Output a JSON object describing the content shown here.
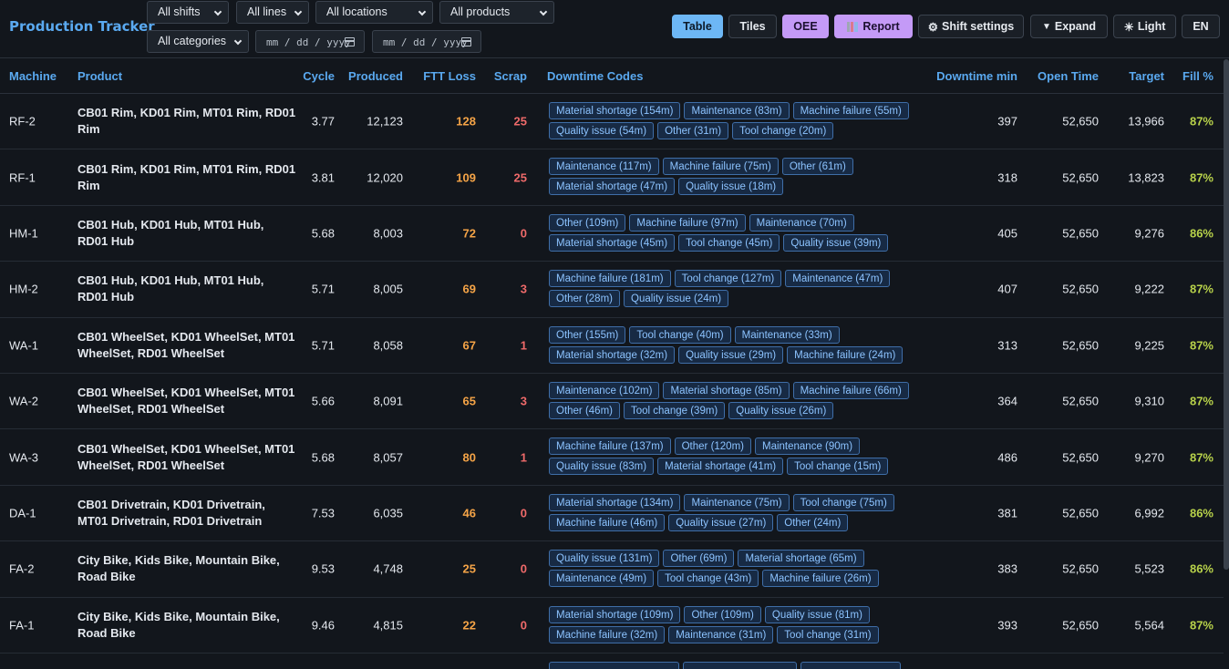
{
  "app": {
    "title": "Production Tracker"
  },
  "filters": {
    "shifts": "All shifts",
    "lines": "All lines",
    "locations": "All locations",
    "products": "All products",
    "categories": "All categories",
    "date_from_placeholder": "mm / dd / yyyy",
    "date_to_placeholder": "mm / dd / yyyy"
  },
  "toolbar": {
    "table": "Table",
    "tiles": "Tiles",
    "oee": "OEE",
    "report": "Report",
    "shift_settings": "Shift settings",
    "expand": "Expand",
    "light": "Light",
    "lang": "EN"
  },
  "colors": {
    "accent": "#5aa9f0",
    "ftt": "#f5a447",
    "scrap": "#ef6a6a",
    "fill": "#b8d24a",
    "active_view": "#6db7f5",
    "purple": "#c49af7"
  },
  "table": {
    "headers": {
      "machine": "Machine",
      "product": "Product",
      "cycle": "Cycle",
      "produced": "Produced",
      "ftt_loss": "FTT Loss",
      "scrap": "Scrap",
      "downtime_codes": "Downtime Codes",
      "downtime_min": "Downtime min",
      "open_time": "Open Time",
      "target": "Target",
      "fill": "Fill %"
    },
    "rows": [
      {
        "machine": "RF-2",
        "product": "CB01 Rim, KD01 Rim, MT01 Rim, RD01 Rim",
        "cycle": "3.77",
        "produced": "12,123",
        "ftt": "128",
        "scrap": "25",
        "codes": [
          "Material shortage (154m)",
          "Maintenance (83m)",
          "Machine failure (55m)",
          "Quality issue (54m)",
          "Other (31m)",
          "Tool change (20m)"
        ],
        "downtime": "397",
        "open": "52,650",
        "target": "13,966",
        "fill": "87%"
      },
      {
        "machine": "RF-1",
        "product": "CB01 Rim, KD01 Rim, MT01 Rim, RD01 Rim",
        "cycle": "3.81",
        "produced": "12,020",
        "ftt": "109",
        "scrap": "25",
        "codes": [
          "Maintenance (117m)",
          "Machine failure (75m)",
          "Other (61m)",
          "Material shortage (47m)",
          "Quality issue (18m)"
        ],
        "downtime": "318",
        "open": "52,650",
        "target": "13,823",
        "fill": "87%"
      },
      {
        "machine": "HM-1",
        "product": "CB01 Hub, KD01 Hub, MT01 Hub, RD01 Hub",
        "cycle": "5.68",
        "produced": "8,003",
        "ftt": "72",
        "scrap": "0",
        "codes": [
          "Other (109m)",
          "Machine failure (97m)",
          "Maintenance (70m)",
          "Material shortage (45m)",
          "Tool change (45m)",
          "Quality issue (39m)"
        ],
        "downtime": "405",
        "open": "52,650",
        "target": "9,276",
        "fill": "86%"
      },
      {
        "machine": "HM-2",
        "product": "CB01 Hub, KD01 Hub, MT01 Hub, RD01 Hub",
        "cycle": "5.71",
        "produced": "8,005",
        "ftt": "69",
        "scrap": "3",
        "codes": [
          "Machine failure (181m)",
          "Tool change (127m)",
          "Maintenance (47m)",
          "Other (28m)",
          "Quality issue (24m)"
        ],
        "downtime": "407",
        "open": "52,650",
        "target": "9,222",
        "fill": "87%"
      },
      {
        "machine": "WA-1",
        "product": "CB01 WheelSet, KD01 WheelSet, MT01 WheelSet, RD01 WheelSet",
        "cycle": "5.71",
        "produced": "8,058",
        "ftt": "67",
        "scrap": "1",
        "codes": [
          "Other (155m)",
          "Tool change (40m)",
          "Maintenance (33m)",
          "Material shortage (32m)",
          "Quality issue (29m)",
          "Machine failure (24m)"
        ],
        "downtime": "313",
        "open": "52,650",
        "target": "9,225",
        "fill": "87%"
      },
      {
        "machine": "WA-2",
        "product": "CB01 WheelSet, KD01 WheelSet, MT01 WheelSet, RD01 WheelSet",
        "cycle": "5.66",
        "produced": "8,091",
        "ftt": "65",
        "scrap": "3",
        "codes": [
          "Maintenance (102m)",
          "Material shortage (85m)",
          "Machine failure (66m)",
          "Other (46m)",
          "Tool change (39m)",
          "Quality issue (26m)"
        ],
        "downtime": "364",
        "open": "52,650",
        "target": "9,310",
        "fill": "87%"
      },
      {
        "machine": "WA-3",
        "product": "CB01 WheelSet, KD01 WheelSet, MT01 WheelSet, RD01 WheelSet",
        "cycle": "5.68",
        "produced": "8,057",
        "ftt": "80",
        "scrap": "1",
        "codes": [
          "Machine failure (137m)",
          "Other (120m)",
          "Maintenance (90m)",
          "Quality issue (83m)",
          "Material shortage (41m)",
          "Tool change (15m)"
        ],
        "downtime": "486",
        "open": "52,650",
        "target": "9,270",
        "fill": "87%"
      },
      {
        "machine": "DA-1",
        "product": "CB01 Drivetrain, KD01 Drivetrain, MT01 Drivetrain, RD01 Drivetrain",
        "cycle": "7.53",
        "produced": "6,035",
        "ftt": "46",
        "scrap": "0",
        "codes": [
          "Material shortage (134m)",
          "Maintenance (75m)",
          "Tool change (75m)",
          "Machine failure (46m)",
          "Quality issue (27m)",
          "Other (24m)"
        ],
        "downtime": "381",
        "open": "52,650",
        "target": "6,992",
        "fill": "86%"
      },
      {
        "machine": "FA-2",
        "product": "City Bike, Kids Bike, Mountain Bike, Road Bike",
        "cycle": "9.53",
        "produced": "4,748",
        "ftt": "25",
        "scrap": "0",
        "codes": [
          "Quality issue (131m)",
          "Other (69m)",
          "Material shortage (65m)",
          "Maintenance (49m)",
          "Tool change (43m)",
          "Machine failure (26m)"
        ],
        "downtime": "383",
        "open": "52,650",
        "target": "5,523",
        "fill": "86%"
      },
      {
        "machine": "FA-1",
        "product": "City Bike, Kids Bike, Mountain Bike, Road Bike",
        "cycle": "9.46",
        "produced": "4,815",
        "ftt": "22",
        "scrap": "0",
        "codes": [
          "Material shortage (109m)",
          "Other (109m)",
          "Quality issue (81m)",
          "Machine failure (32m)",
          "Maintenance (31m)",
          "Tool change (31m)"
        ],
        "downtime": "393",
        "open": "52,650",
        "target": "5,564",
        "fill": "87%"
      }
    ]
  }
}
